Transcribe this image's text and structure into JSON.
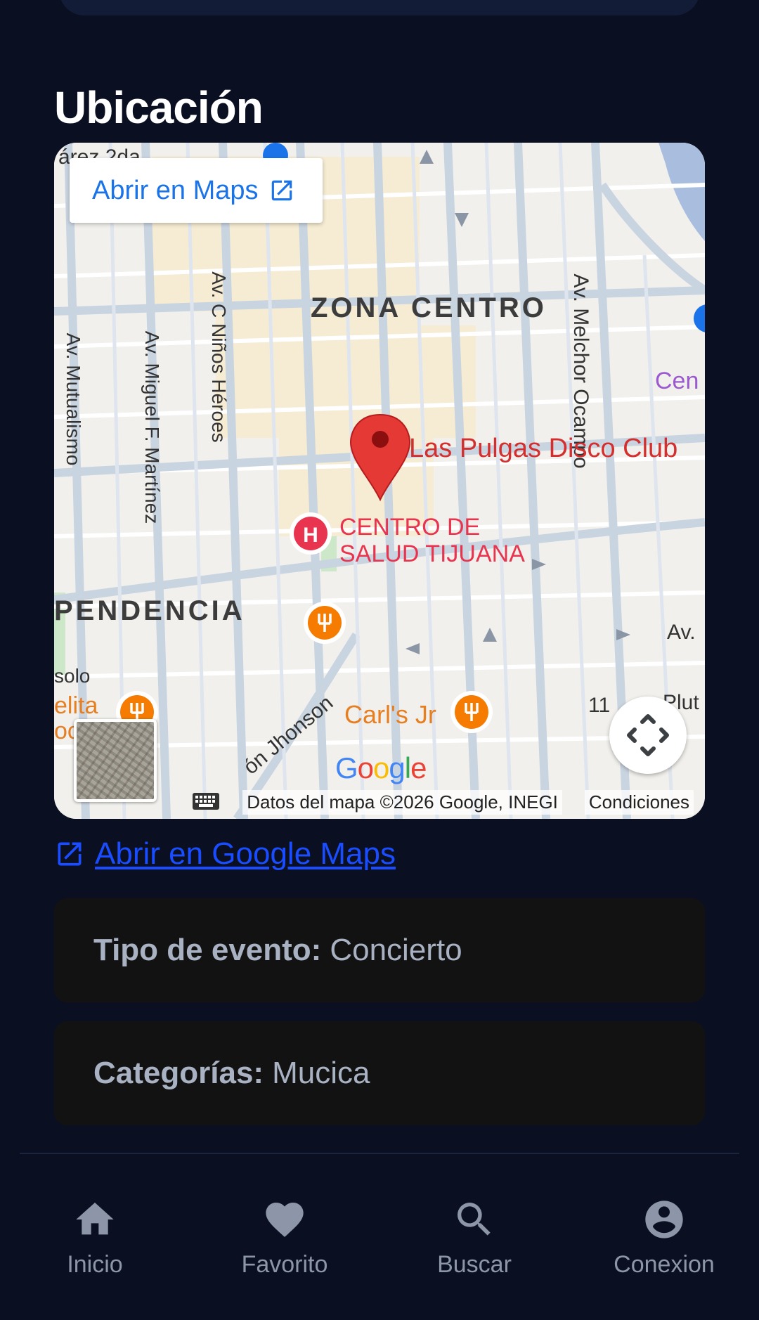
{
  "location": {
    "title": "Ubicación"
  },
  "map": {
    "open_button_label": "Abrir en Maps",
    "place_label": "Las Pulgas Disco Club",
    "labels": {
      "zona_centro": "ZONA CENTRO",
      "independencia": "PENDENCIA",
      "av_mutualismo": "Av. Mutualismo",
      "av_miguel": "Av. Miguel F. Martínez",
      "av_ninos": "Av. C Niños Héroes",
      "av_melchor": "Av. Melchor Ocampo",
      "centro_salud_1": "CENTRO DE",
      "centro_salud_2": "SALUD TIJUANA",
      "carls": "Carl's Jr",
      "jhonson": "ón Jhonson",
      "solo": "solo",
      "elita": "elita",
      "oc": "oc",
      "cen": "Cen",
      "av_right": "Av.",
      "plut": "Plut",
      "num_11": "11",
      "razo": "árez 2da"
    },
    "google_logo": [
      "G",
      "o",
      "o",
      "g",
      "l",
      "e"
    ],
    "footer_data": "Datos del mapa ©2026 Google, INEGI",
    "footer_terms": "Condiciones",
    "colors": {
      "pin": "#e53935",
      "restaurant": "#f57c00",
      "hospital": "#e8344e",
      "link_blue": "#1a73e8"
    }
  },
  "link": {
    "label": "Abrir en Google Maps"
  },
  "details": {
    "event_type_label": "Tipo de evento:",
    "event_type_value": "Concierto",
    "categories_label": "Categorías:",
    "categories_value": "Mucica"
  },
  "nav": {
    "items": [
      {
        "label": "Inicio",
        "icon": "home-icon"
      },
      {
        "label": "Favorito",
        "icon": "heart-icon"
      },
      {
        "label": "Buscar",
        "icon": "search-icon"
      },
      {
        "label": "Conexion",
        "icon": "account-icon"
      }
    ]
  }
}
